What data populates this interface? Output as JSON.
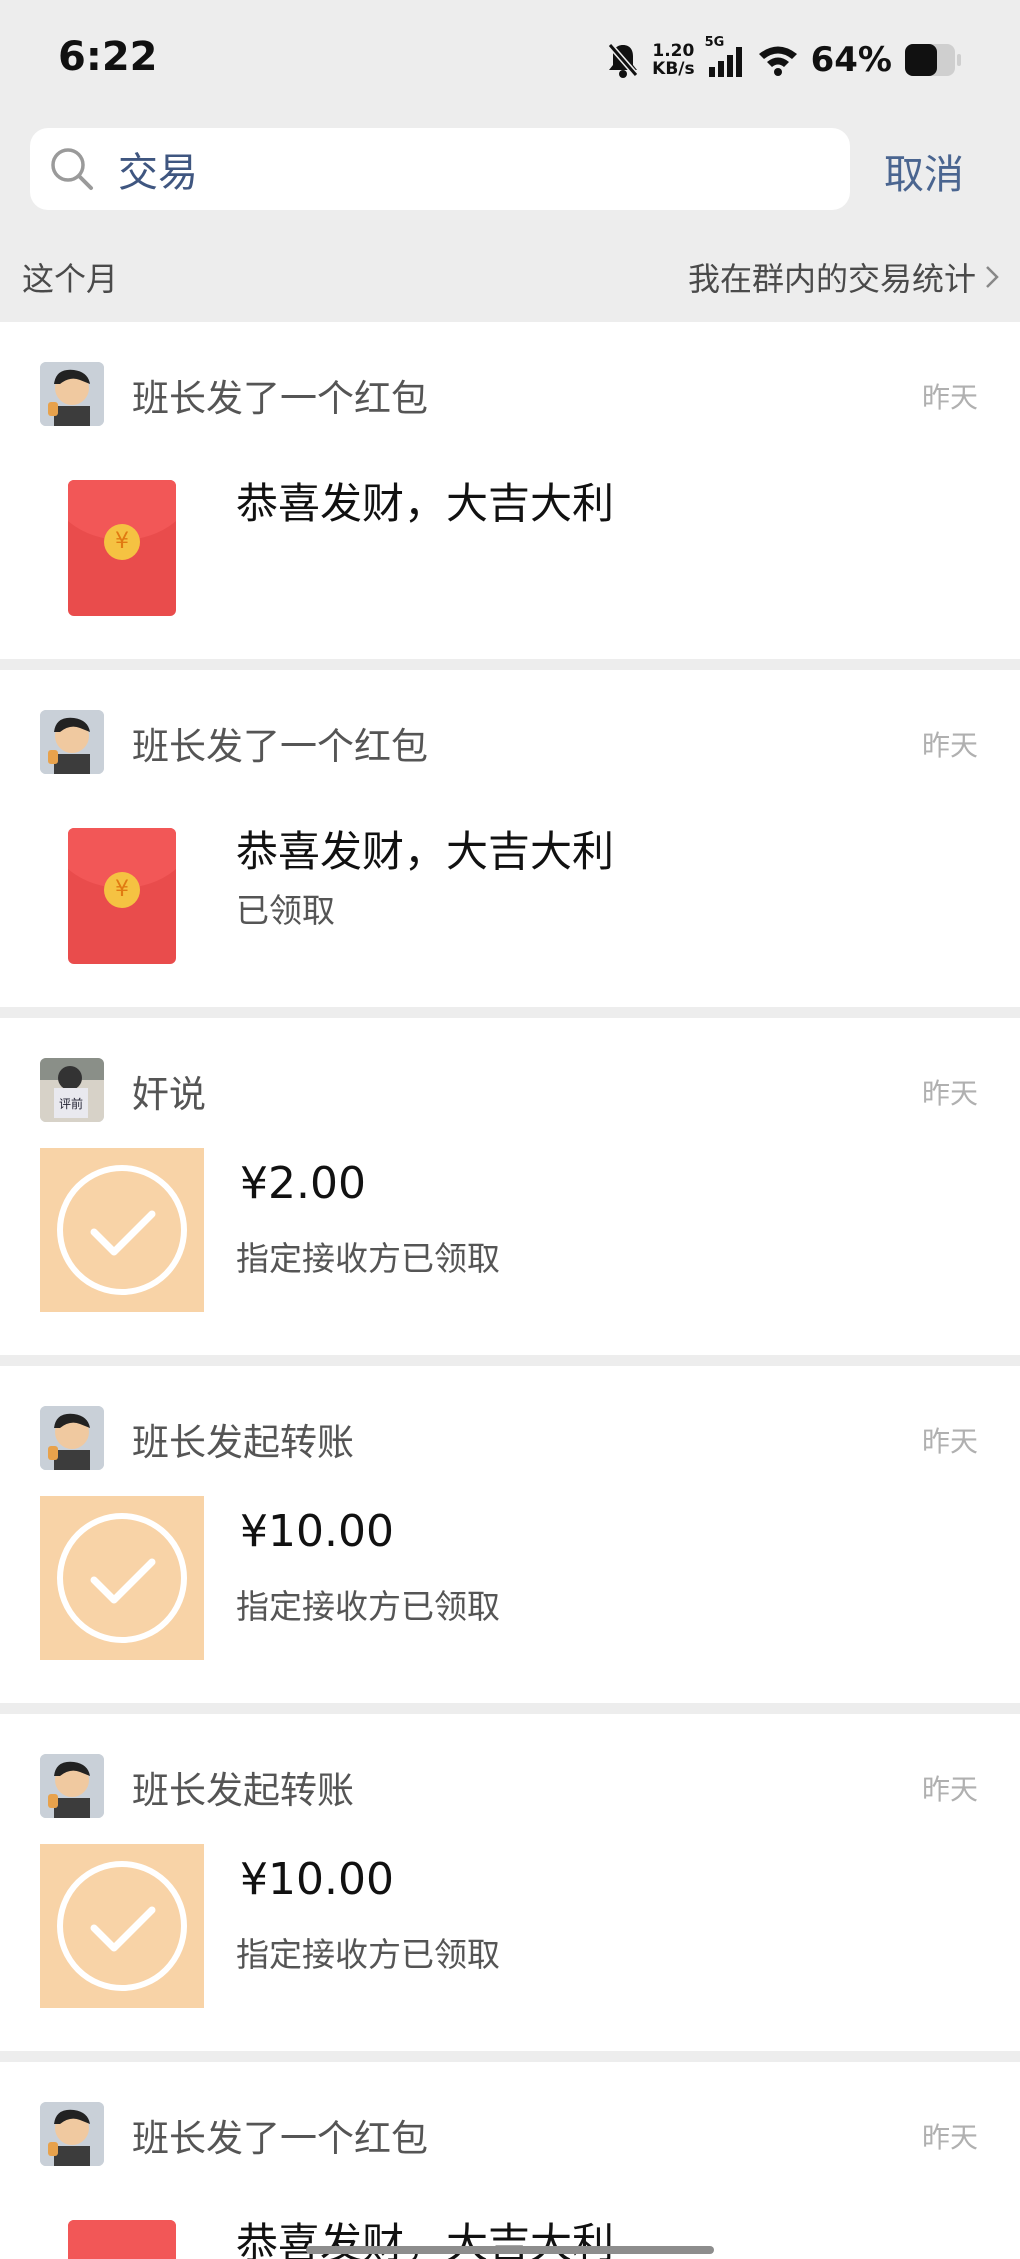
{
  "status_bar": {
    "time": "6:22",
    "net_speed_value": "1.20",
    "net_speed_unit": "KB/s",
    "network_type": "5G",
    "battery_percent": "64%"
  },
  "search": {
    "value": "交易",
    "cancel_label": "取消"
  },
  "filter": {
    "period_label": "这个月",
    "stats_link_label": "我在群内的交易统计"
  },
  "colors": {
    "red_packet": "#e94c4c",
    "transfer_bg": "#f8d3a7",
    "link_blue": "#4a6590"
  },
  "items": [
    {
      "type": "red-packet",
      "title": "班长发了一个红包",
      "time": "昨天",
      "message": "恭喜发财，大吉大利",
      "status": ""
    },
    {
      "type": "red-packet",
      "title": "班长发了一个红包",
      "time": "昨天",
      "message": "恭喜发财，大吉大利",
      "status": "已领取"
    },
    {
      "type": "transfer",
      "title": "奸说",
      "time": "昨天",
      "amount": "¥2.00",
      "status": "指定接收方已领取"
    },
    {
      "type": "transfer",
      "title": "班长发起转账",
      "time": "昨天",
      "amount": "¥10.00",
      "status": "指定接收方已领取"
    },
    {
      "type": "transfer",
      "title": "班长发起转账",
      "time": "昨天",
      "amount": "¥10.00",
      "status": "指定接收方已领取"
    },
    {
      "type": "red-packet",
      "title": "班长发了一个红包",
      "time": "昨天",
      "message": "恭喜发财，大吉大利",
      "status": ""
    }
  ]
}
